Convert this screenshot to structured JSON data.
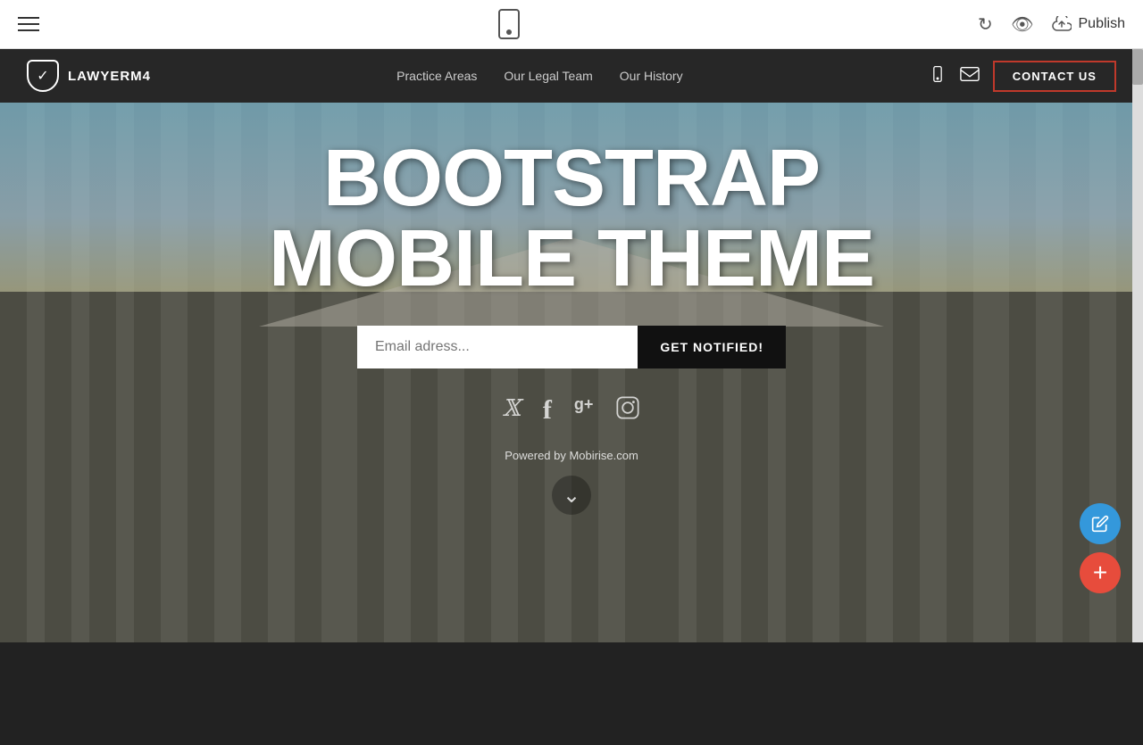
{
  "editor": {
    "publish_label": "Publish",
    "undo_symbol": "↺",
    "eye_symbol": "👁"
  },
  "navbar": {
    "logo_text": "LAWYERM4",
    "nav_links": [
      {
        "label": "Practice Areas",
        "id": "practice-areas"
      },
      {
        "label": "Our Legal Team",
        "id": "legal-team"
      },
      {
        "label": "Our History",
        "id": "our-history"
      }
    ],
    "contact_us_label": "CONTACT US"
  },
  "hero": {
    "title_line1": "BOOTSTRAP",
    "title_line2": "MOBILE THEME",
    "email_placeholder": "Email adress...",
    "notify_button_label": "GET NOTIFIED!",
    "powered_text": "Powered by Mobirise.com",
    "social_icons": [
      {
        "name": "twitter",
        "symbol": "𝕏"
      },
      {
        "name": "facebook",
        "symbol": "f"
      },
      {
        "name": "google-plus",
        "symbol": "g+"
      },
      {
        "name": "instagram",
        "symbol": "📷"
      }
    ]
  },
  "colors": {
    "contact_border": "#c0392b",
    "fab_pencil_bg": "#3498db",
    "fab_plus_bg": "#e74c3c",
    "navbar_bg": "rgba(40,40,40,0.92)"
  }
}
